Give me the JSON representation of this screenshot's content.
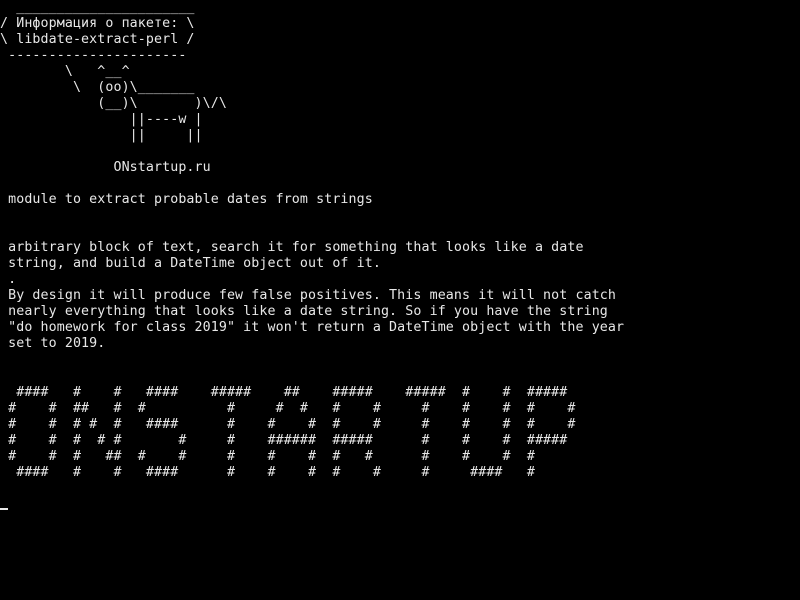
{
  "terminal": {
    "cowsay": "  ______________________\n/ Информация о пакете: \\\n\\ libdate-extract-perl /\n ----------------------\n        \\   ^__^\n         \\  (oo)\\_______\n            (__)\\       )\\/\\\n                ||----w |\n                ||     ||\n\n              ONstartup.ru",
    "summary": " module to extract probable dates from strings",
    "description": " arbitrary block of text, search it for something that looks like a date\n string, and build a DateTime object out of it.\n .\n By design it will produce few false positives. This means it will not catch\n nearly everything that looks like a date string. So if you have the string\n \"do homework for class 2019\" it won't return a DateTime object with the year\n set to 2019.",
    "banner": "  ####   #    #   ####    #####    ##    #####    #####  #    #  #####\n #    #  ##   #  #          #     #  #   #    #     #    #    #  #    #\n #    #  # #  #   ####      #    #    #  #    #     #    #    #  #    #\n #    #  #  # #       #     #    ######  #####      #    #    #  #####\n #    #  #   ##  #    #     #    #    #  #   #      #    #    #  #\n  ####   #    #   ####      #    #    #  #    #     #     ####   #"
  }
}
